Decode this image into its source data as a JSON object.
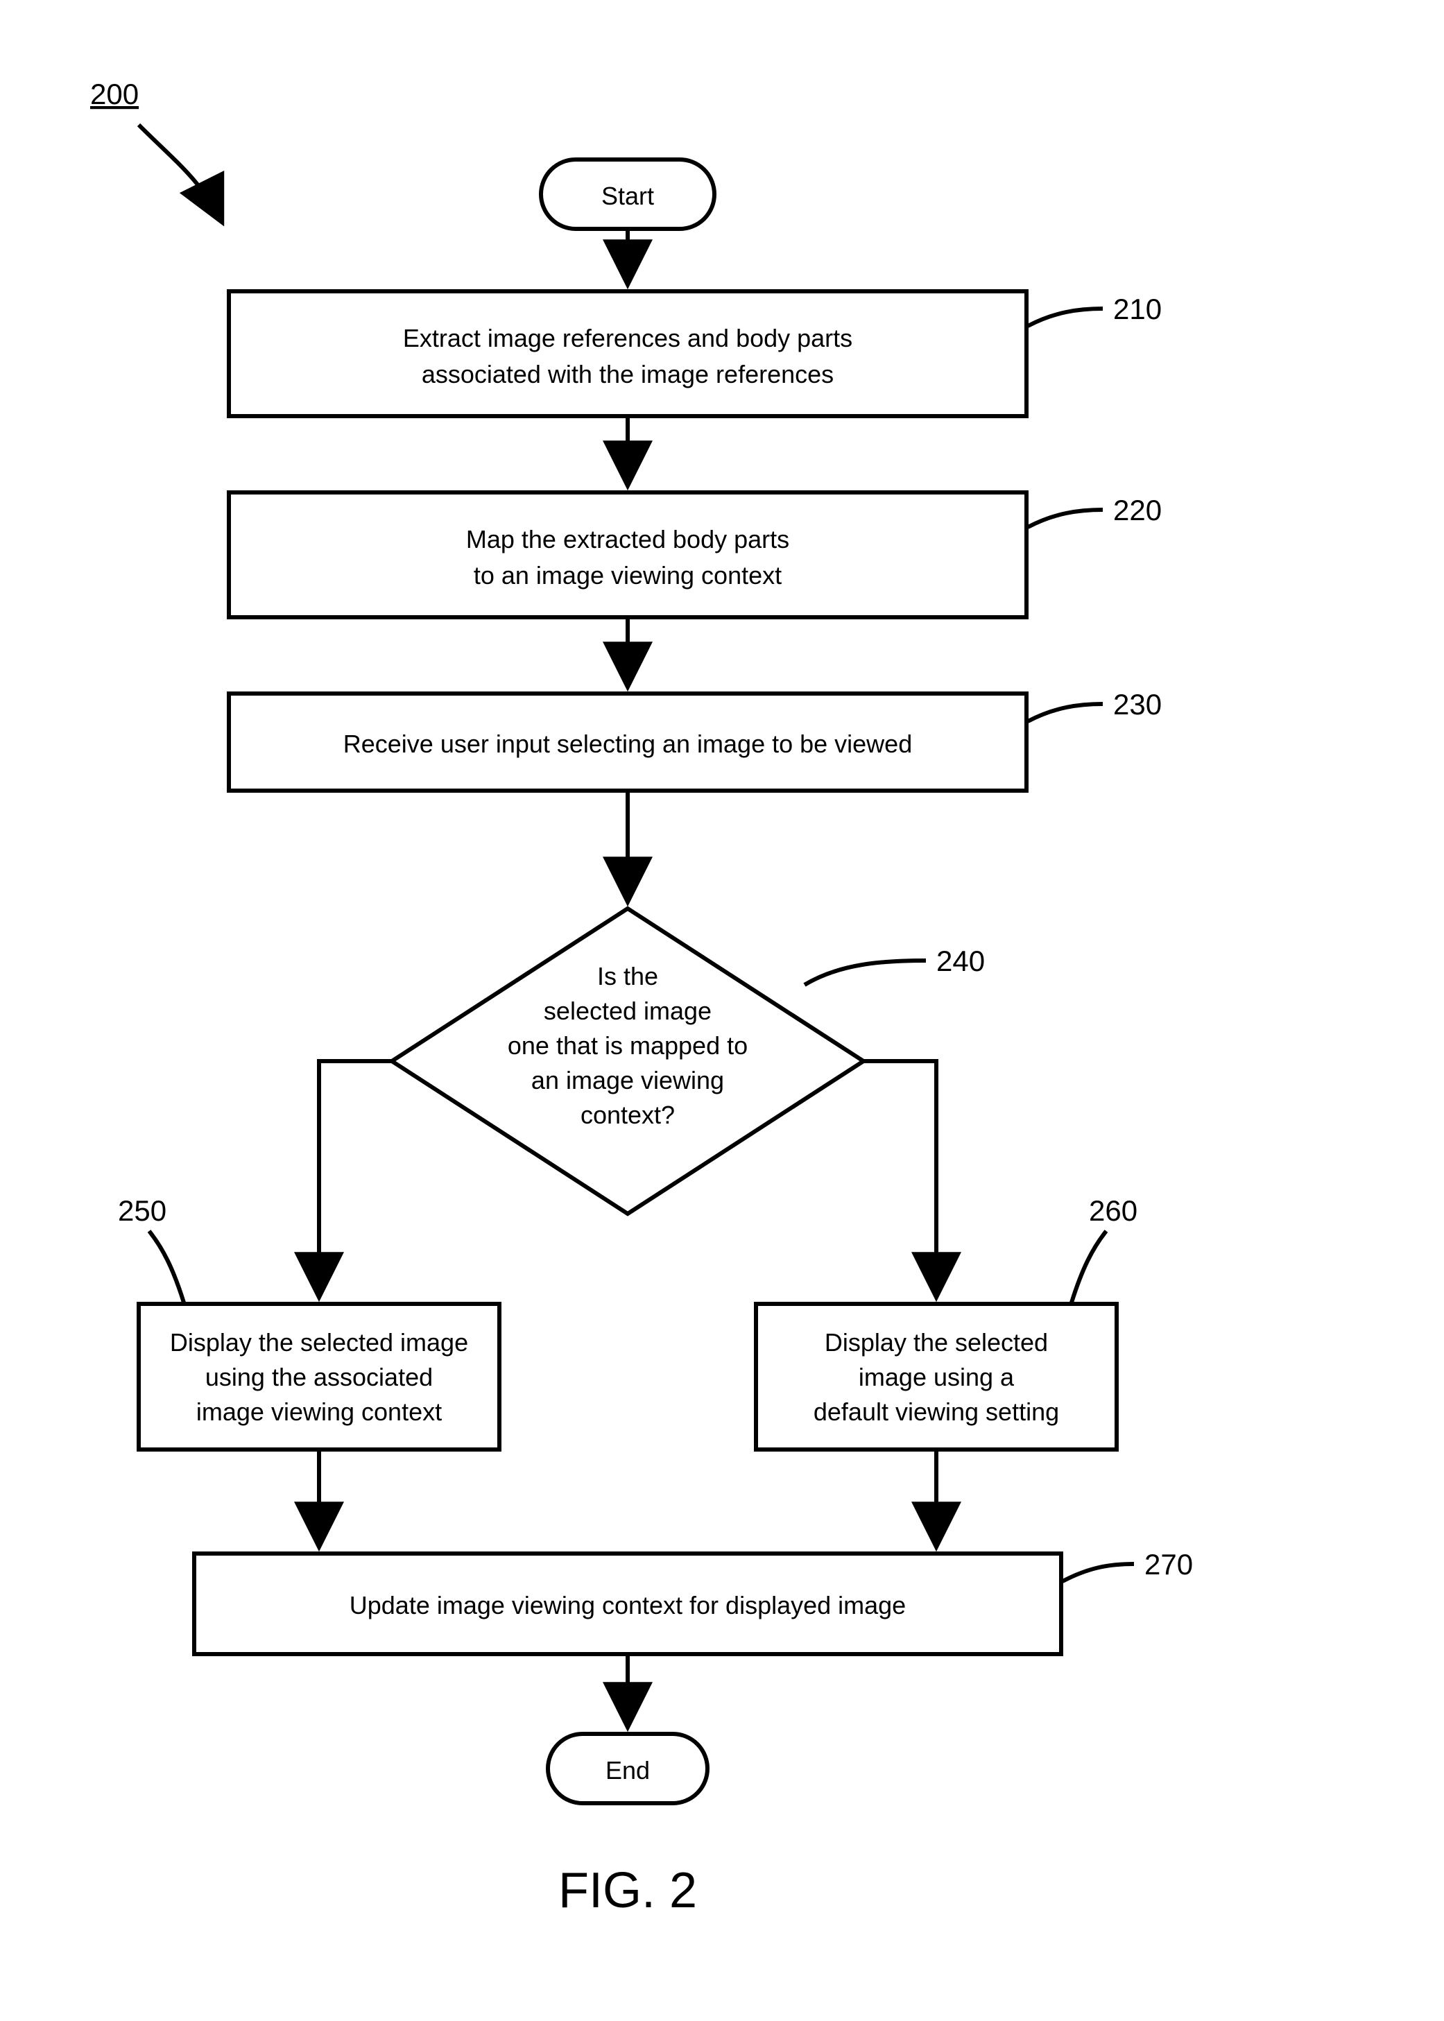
{
  "figure_ref": "200",
  "figure_label": "FIG. 2",
  "steps": {
    "start": "Start",
    "s210": {
      "ref": "210",
      "lines": [
        "Extract image references and body parts",
        "associated with the image references"
      ]
    },
    "s220": {
      "ref": "220",
      "lines": [
        "Map the extracted body parts",
        "to an image viewing context"
      ]
    },
    "s230": {
      "ref": "230",
      "lines": [
        "Receive user input selecting an image to be viewed"
      ]
    },
    "s240": {
      "ref": "240",
      "lines": [
        "Is the",
        "selected image",
        "one that is mapped to",
        "an image viewing",
        "context?"
      ]
    },
    "s250": {
      "ref": "250",
      "lines": [
        "Display the selected image",
        "using the associated",
        "image viewing context"
      ]
    },
    "s260": {
      "ref": "260",
      "lines": [
        "Display the selected",
        "image using a",
        "default viewing setting"
      ]
    },
    "s270": {
      "ref": "270",
      "lines": [
        "Update image viewing context for displayed image"
      ]
    },
    "end": "End"
  }
}
